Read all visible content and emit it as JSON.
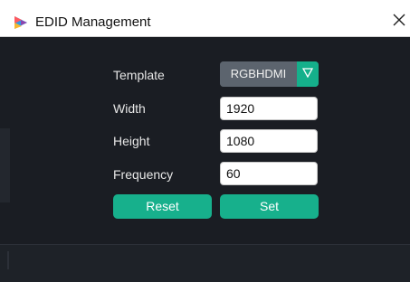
{
  "window": {
    "title": "EDID Management",
    "app_icon": "play-logo-icon",
    "close_icon": "close-icon"
  },
  "form": {
    "template": {
      "label": "Template",
      "value": "RGBHDMI",
      "arrow_icon": "triangle-down-icon"
    },
    "width": {
      "label": "Width",
      "value": "1920"
    },
    "height": {
      "label": "Height",
      "value": "1080"
    },
    "frequency": {
      "label": "Frequency",
      "value": "60"
    }
  },
  "buttons": {
    "reset_label": "Reset",
    "set_label": "Set"
  },
  "colors": {
    "accent": "#17b08c",
    "background": "#1a1d23",
    "select_bg": "#5c646e"
  }
}
